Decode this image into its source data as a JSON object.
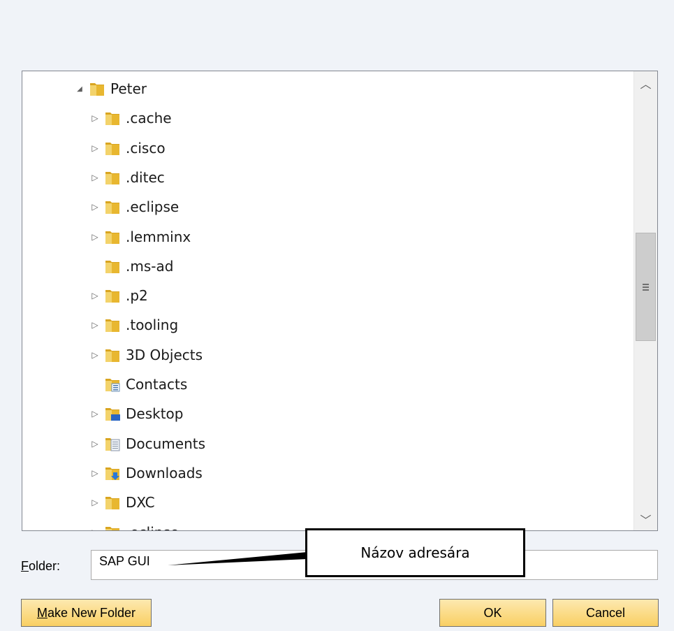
{
  "tree": {
    "items": [
      {
        "label": "Peter",
        "expander": "expanded",
        "icon": "folder-icon"
      },
      {
        "label": ".cache",
        "expander": "collapsed",
        "icon": "folder-icon"
      },
      {
        "label": ".cisco",
        "expander": "collapsed",
        "icon": "folder-icon"
      },
      {
        "label": ".ditec",
        "expander": "collapsed",
        "icon": "folder-icon"
      },
      {
        "label": ".eclipse",
        "expander": "collapsed",
        "icon": "folder-icon"
      },
      {
        "label": ".lemminx",
        "expander": "collapsed",
        "icon": "folder-icon"
      },
      {
        "label": ".ms-ad",
        "expander": "none",
        "icon": "folder-icon"
      },
      {
        "label": ".p2",
        "expander": "collapsed",
        "icon": "folder-icon"
      },
      {
        "label": ".tooling",
        "expander": "collapsed",
        "icon": "folder-icon"
      },
      {
        "label": "3D Objects",
        "expander": "collapsed",
        "icon": "folder-icon"
      },
      {
        "label": "Contacts",
        "expander": "none",
        "icon": "contacts-folder-icon"
      },
      {
        "label": "Desktop",
        "expander": "collapsed",
        "icon": "desktop-folder-icon"
      },
      {
        "label": "Documents",
        "expander": "collapsed",
        "icon": "documents-folder-icon"
      },
      {
        "label": "Downloads",
        "expander": "collapsed",
        "icon": "downloads-folder-icon"
      },
      {
        "label": "DXC",
        "expander": "collapsed",
        "icon": "folder-icon"
      },
      {
        "label": ".eclipse",
        "expander": "collapsed",
        "icon": "folder-icon"
      }
    ]
  },
  "folder_field": {
    "label": "Folder:",
    "value": "SAP GUI"
  },
  "buttons": {
    "make_new_folder": "Make New Folder",
    "ok": "OK",
    "cancel": "Cancel"
  },
  "callout": {
    "text": "Názov adresára"
  },
  "colors": {
    "button_fill": "#f9cf63",
    "folder_yellow": "#e8b730"
  }
}
